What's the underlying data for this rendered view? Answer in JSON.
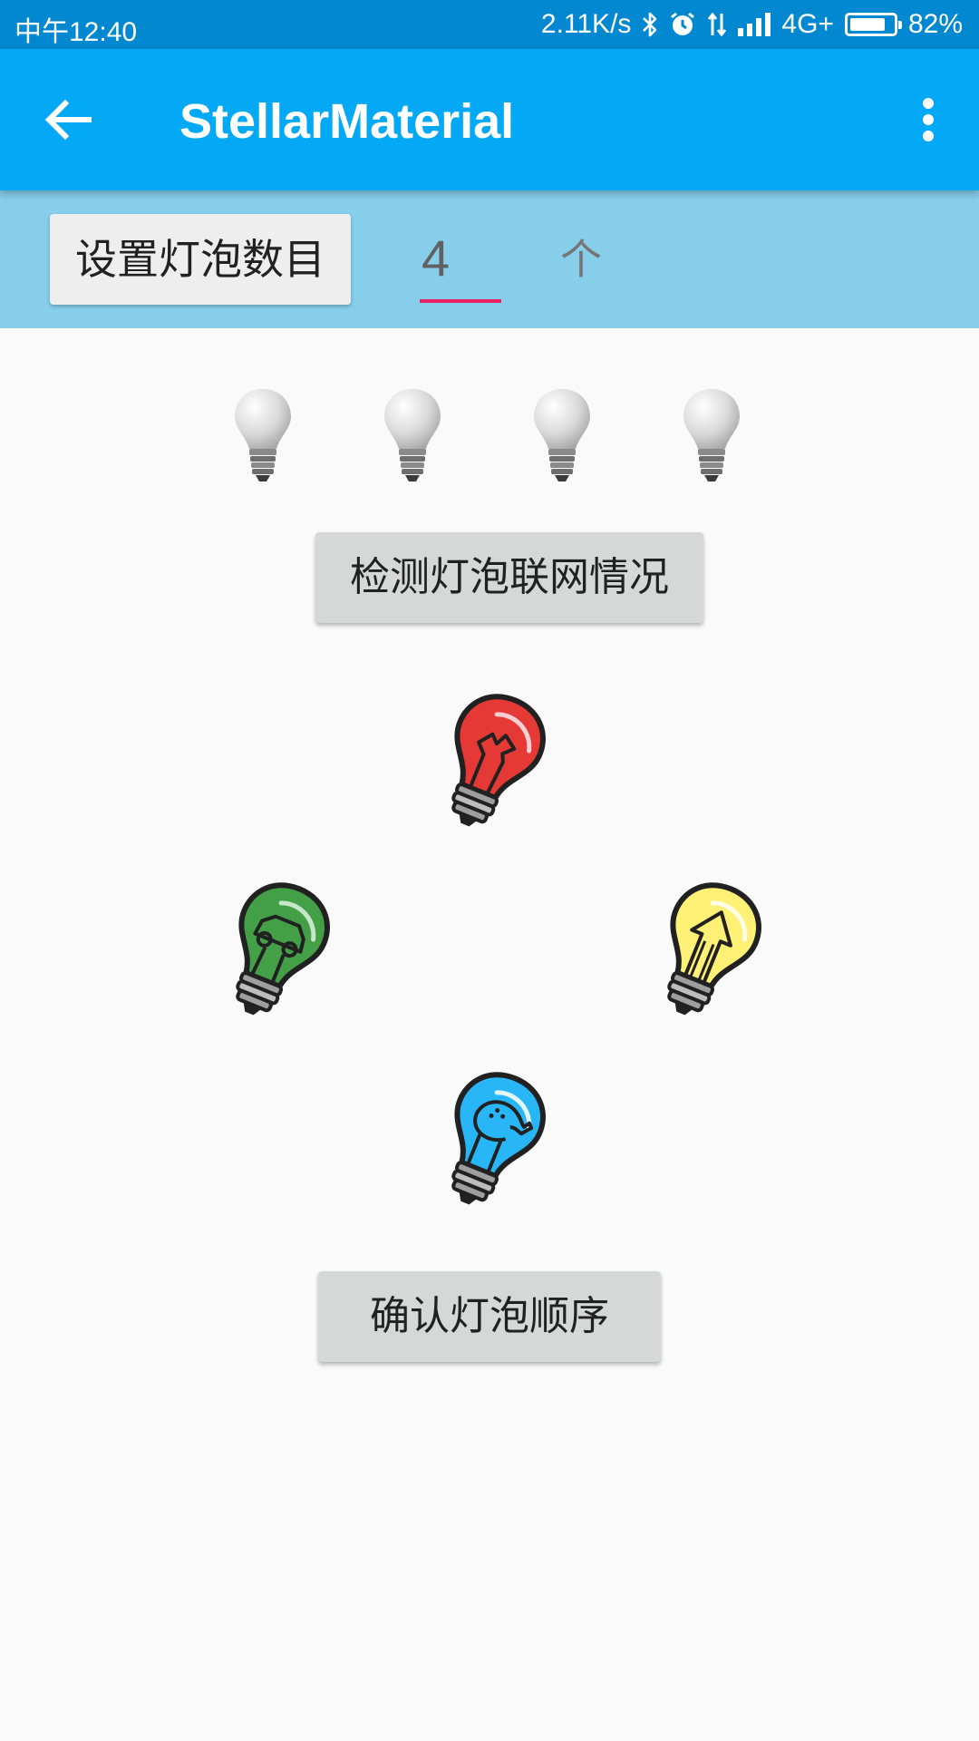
{
  "status_bar": {
    "time": "中午12:40",
    "network_speed": "2.11K/s",
    "network_type": "4G+",
    "battery_percent": "82%",
    "battery_level": 0.82,
    "icons": [
      "bluetooth-icon",
      "alarm-icon",
      "data-transfer-icon",
      "signal-icon",
      "battery-icon"
    ]
  },
  "app_bar": {
    "title": "StellarMaterial",
    "color": "#03a9f4",
    "icons": [
      "back-arrow-icon",
      "more-vert-icon"
    ]
  },
  "count_setting": {
    "button_label": "设置灯泡数目",
    "value": "4",
    "unit": "个",
    "strip_color": "#87ceeb",
    "underline_color": "#e91e63"
  },
  "gray_bulbs": {
    "count": 4,
    "icon": "gray-lightbulb-icon"
  },
  "check_button": {
    "label": "检测灯泡联网情况"
  },
  "color_bulbs": [
    {
      "name": "red-bulb",
      "color": "#e53935",
      "icon": "wrench-icon"
    },
    {
      "name": "green-bulb",
      "color": "#43a047",
      "icon": "car-icon"
    },
    {
      "name": "yellow-bulb",
      "color": "#fff176",
      "icon": "arrow-up-icon"
    },
    {
      "name": "blue-bulb",
      "color": "#29b6f6",
      "icon": "shower-icon"
    }
  ],
  "confirm_button": {
    "label": "确认灯泡顺序"
  }
}
